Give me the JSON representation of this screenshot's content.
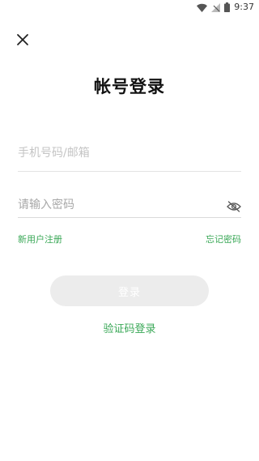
{
  "status_bar": {
    "time": "9:37",
    "icons": [
      "wifi-icon",
      "no-signal-icon",
      "battery-icon"
    ]
  },
  "header": {
    "close_icon": "close-icon",
    "title": "帐号登录"
  },
  "form": {
    "account": {
      "placeholder": "手机号码/邮箱",
      "value": ""
    },
    "password": {
      "placeholder": "请输入密码",
      "value": "",
      "toggle_icon": "eye-off-icon"
    }
  },
  "links": {
    "register": "新用户注册",
    "forgot_password": "忘记密码",
    "sms_login": "验证码登录"
  },
  "buttons": {
    "login": "登录",
    "login_enabled": false
  },
  "colors": {
    "accent": "#3aa857",
    "button_disabled_bg": "#ececec",
    "title": "#111111"
  }
}
